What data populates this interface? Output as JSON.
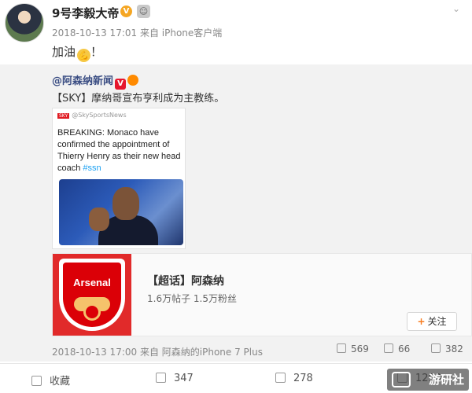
{
  "post": {
    "author": "9号李毅大帝",
    "verified_badge": "V",
    "meta": "2018-10-13 17:01 来自 iPhone客户端",
    "text": "加油",
    "emoji": "strong-arm-emoji"
  },
  "repost": {
    "author": "@阿森纳新闻",
    "author_badge": "V",
    "text": "【SKY】摩纳哥宣布亨利成为主教练。",
    "tweet": {
      "handle": "@SkySportsNews",
      "logo_text": "SKY",
      "body": "BREAKING: Monaco have confirmed the appointment of Thierry Henry as their new head coach ",
      "hashtag": "#ssn"
    },
    "topic_card": {
      "crest_text": "Arsenal",
      "title": "【超话】阿森纳",
      "stats": "1.6万帖子 1.5万粉丝",
      "follow_label": "关注"
    },
    "meta": "2018-10-13 17:00 来自 阿森纳的iPhone 7 Plus",
    "repost_count": "569",
    "comment_count": "66",
    "like_count": "382"
  },
  "bottom_bar": {
    "favorite_label": "收藏",
    "repost_count": "347",
    "comment_count": "278",
    "like_count": "1293"
  },
  "watermark": "游研社",
  "colors": {
    "link_blue": "#3a4d83",
    "weibo_red": "#e6162d",
    "follow_orange": "#f87d20",
    "arsenal_red": "#db0007"
  }
}
